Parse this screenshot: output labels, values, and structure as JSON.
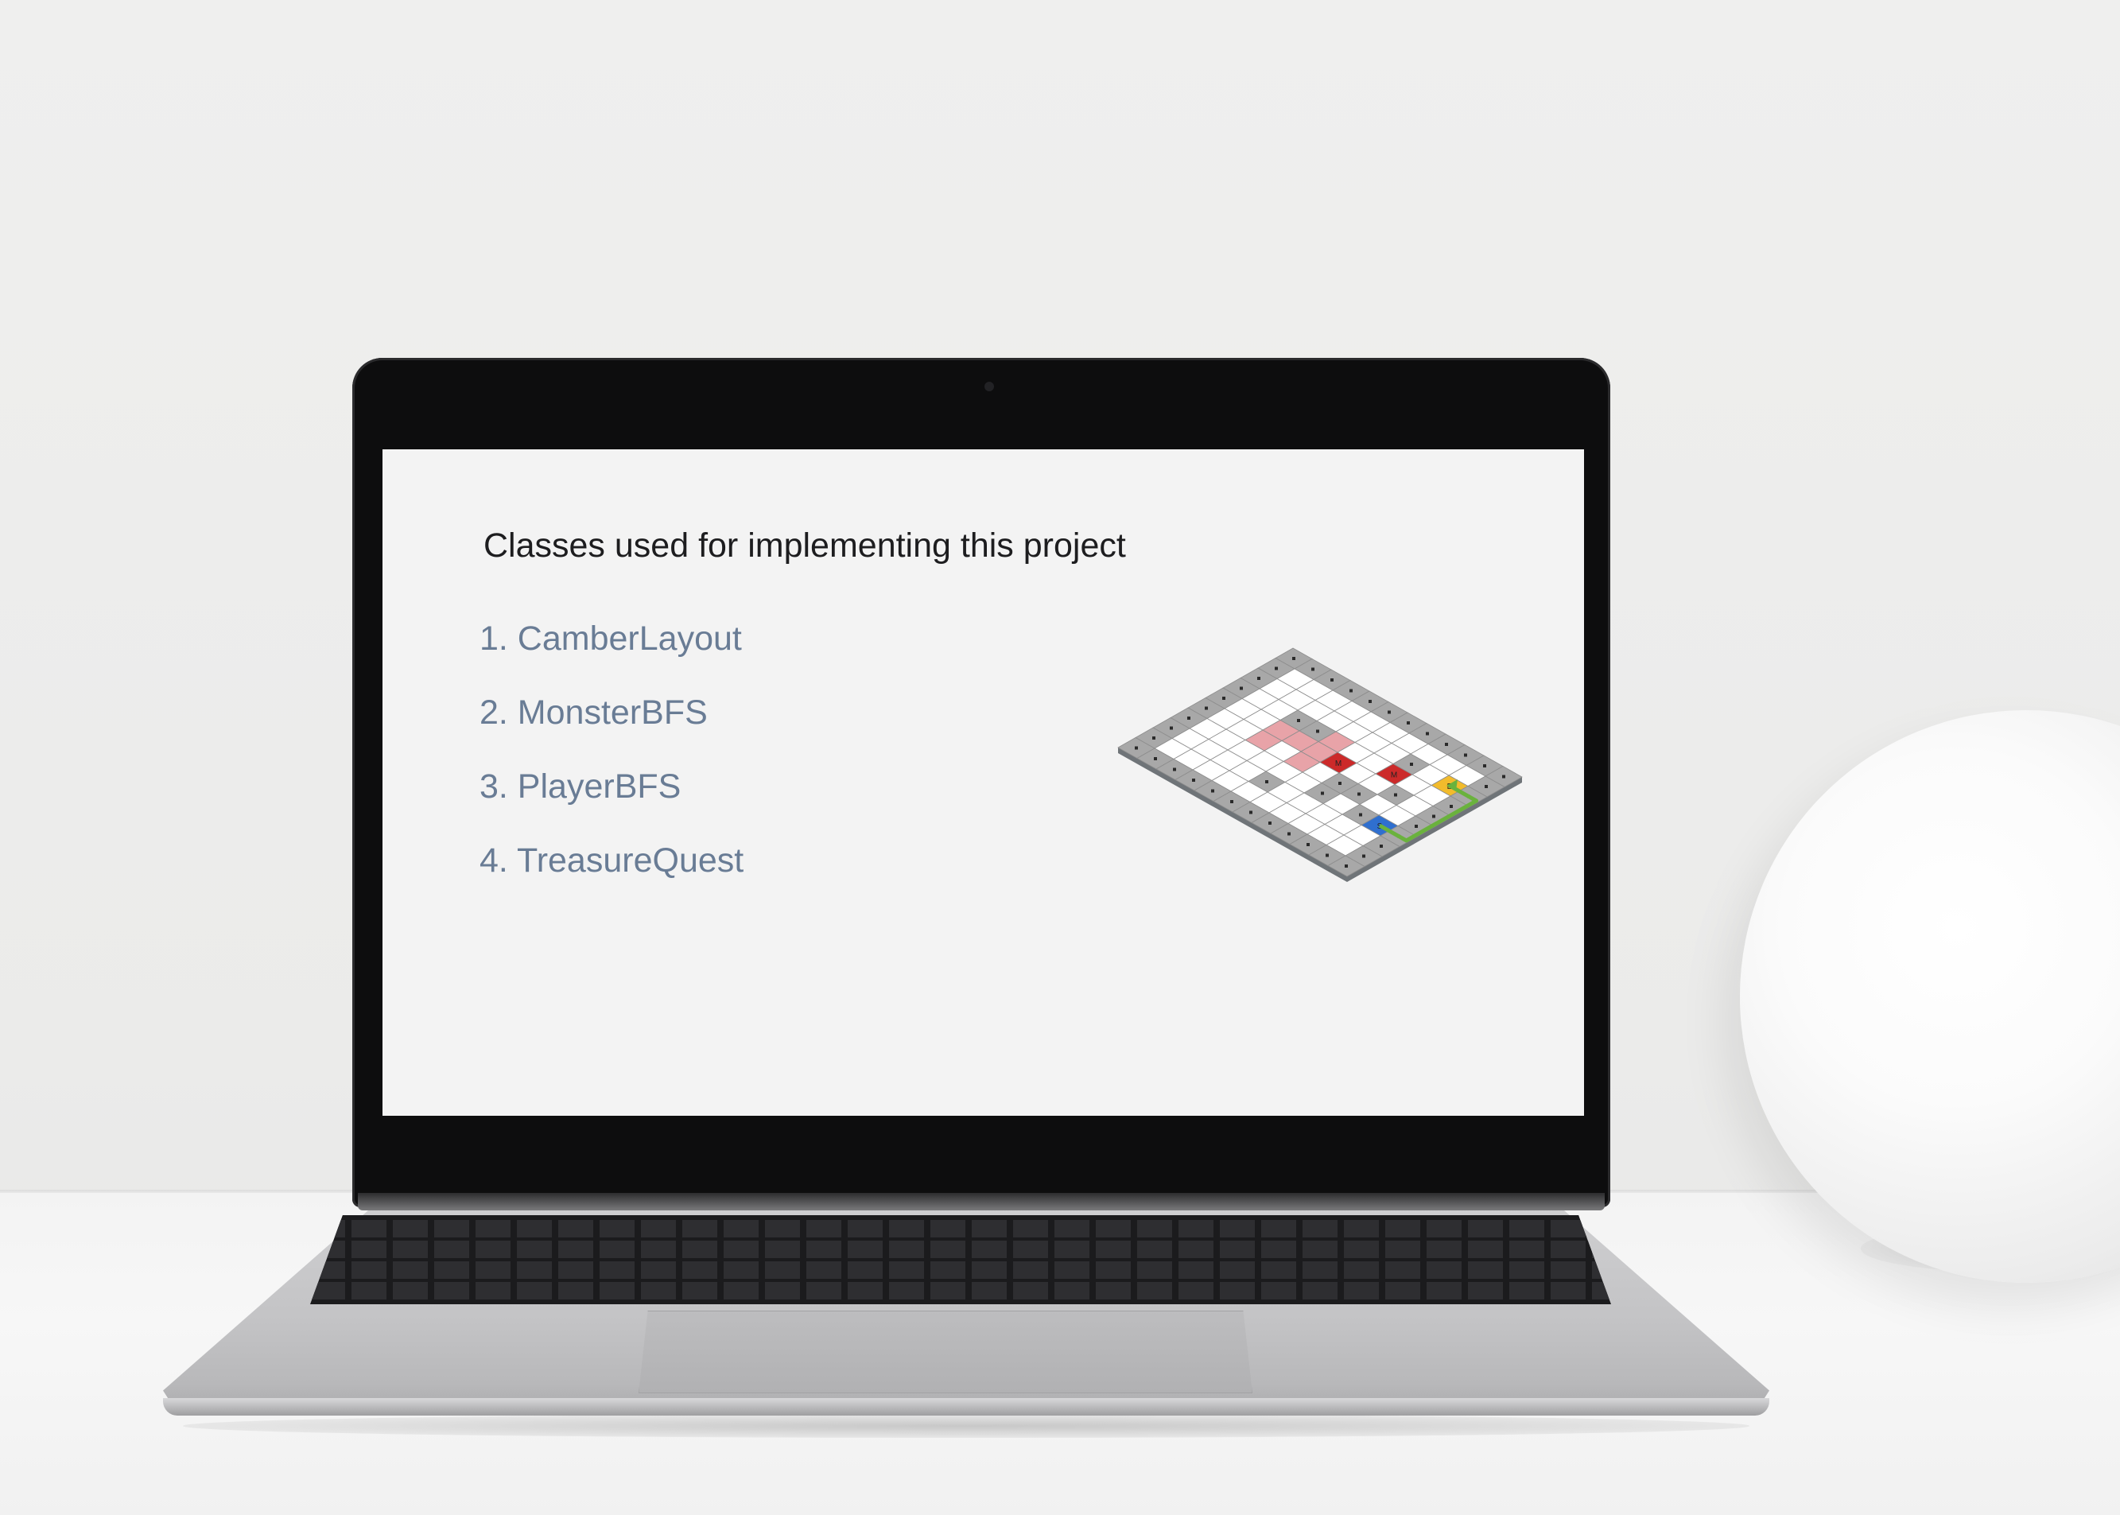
{
  "slide": {
    "title": "Classes used for implementing this project",
    "classes": [
      "1. CamberLayout",
      "2. MonsterBFS",
      "3. PlayerBFS",
      "4. TreasureQuest"
    ]
  },
  "illustration": {
    "grid_rows": 10,
    "grid_cols": 12,
    "cell_labels": {
      "monster": "M",
      "exit": "E",
      "start": "S"
    },
    "colors": {
      "wall": "#a8a8a8",
      "floor": "#ffffff",
      "monster": "#cc2a2a",
      "monster_zone": "#e8a3a8",
      "exit": "#f2bb2c",
      "start": "#2f6fcf",
      "path": "#6ab23d"
    }
  }
}
